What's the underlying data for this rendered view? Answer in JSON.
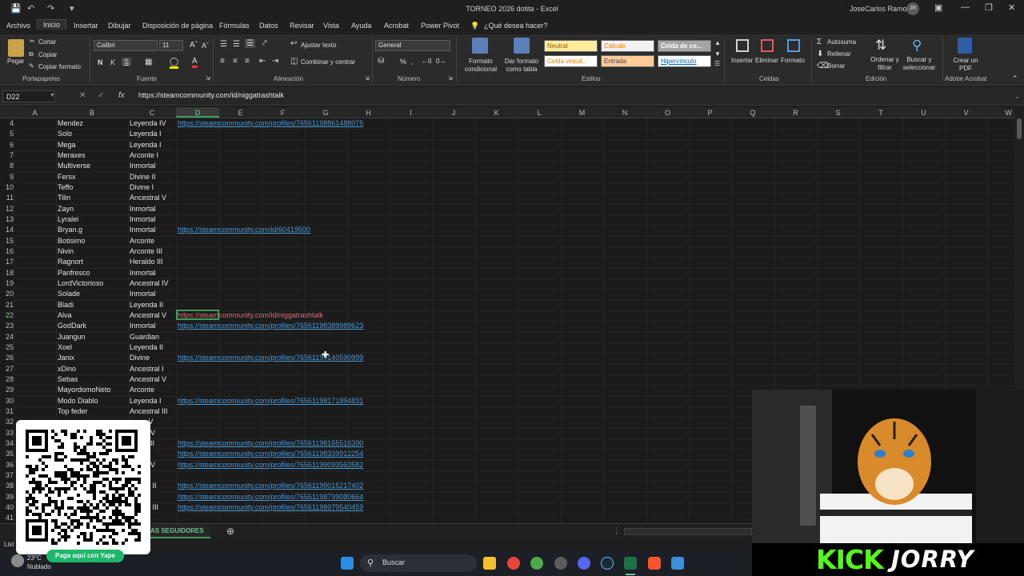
{
  "titlebar": {
    "title": "TORNEO 2026 dotita  -  Excel",
    "user": "JoseCarlos Ramos",
    "user_initials": "JR"
  },
  "ribbon_tabs": [
    "Archivo",
    "Inicio",
    "Insertar",
    "Dibujar",
    "Disposición de página",
    "Fórmulas",
    "Datos",
    "Revisar",
    "Vista",
    "Ayuda",
    "Acrobat",
    "Power Pivot"
  ],
  "tell_me": "¿Qué desea hacer?",
  "ribbon": {
    "clipboard": {
      "paste": "Pegar",
      "cut": "Cortar",
      "copy": "Copiar",
      "format_painter": "Copiar formato",
      "label": "Portapapeles"
    },
    "font": {
      "name": "Calibri",
      "size": "11",
      "label": "Fuente",
      "bold": "N",
      "italic": "K",
      "underline": "S"
    },
    "alignment": {
      "wrap": "Ajustar texto",
      "merge": "Combinar y centrar",
      "label": "Alineación"
    },
    "number": {
      "format": "General",
      "label": "Número",
      "percent": "%"
    },
    "styles": {
      "conditional": "Formato condicional",
      "as_table": "Dar formato como tabla",
      "label": "Estilos",
      "cells": [
        "Neutral",
        "Cálculo",
        "Celda de co...",
        "Celda vincul...",
        "Entrada",
        "Hipervínculo"
      ]
    },
    "cells_group": {
      "insert": "Insertar",
      "delete": "Eliminar",
      "format": "Formato",
      "label": "Celdas"
    },
    "editing": {
      "autosum": "Autosuma",
      "fill": "Rellenar",
      "clear": "Borrar",
      "sort": "Ordenar y filtrar",
      "find": "Buscar y seleccionar",
      "label": "Edición"
    },
    "acrobat": {
      "create": "Crear un PDF",
      "label": "Adobe Acrobat"
    }
  },
  "formula_bar": {
    "name_box": "D22",
    "formula": "https://steamcommunity.com/id/niggatrashtalk"
  },
  "columns": [
    "A",
    "B",
    "C",
    "D",
    "E",
    "F",
    "G",
    "H",
    "I",
    "J",
    "K",
    "L",
    "M",
    "N",
    "O",
    "P",
    "Q",
    "R",
    "S",
    "T",
    "U",
    "V",
    "W"
  ],
  "rows": [
    {
      "n": "4",
      "b": "Mendez",
      "c": "Leyenda IV",
      "d": "https://steamcommunity.com/profiles/76561198861488075"
    },
    {
      "n": "5",
      "b": "Solo",
      "c": "Leyenda I",
      "d": ""
    },
    {
      "n": "6",
      "b": "Mega",
      "c": "Leyenda I",
      "d": ""
    },
    {
      "n": "7",
      "b": "Meraxes",
      "c": "Arconte I",
      "d": ""
    },
    {
      "n": "8",
      "b": "Multiverse",
      "c": "Inmortal",
      "d": ""
    },
    {
      "n": "9",
      "b": "Fersx",
      "c": "Divine II",
      "d": ""
    },
    {
      "n": "10",
      "b": "Teffo",
      "c": "Divine I",
      "d": ""
    },
    {
      "n": "11",
      "b": "Tilin",
      "c": "Ancestral V",
      "d": ""
    },
    {
      "n": "12",
      "b": "Zayn",
      "c": "Inmortal",
      "d": ""
    },
    {
      "n": "13",
      "b": "Lyralei",
      "c": "Inmortal",
      "d": ""
    },
    {
      "n": "14",
      "b": "Bryan.g",
      "c": "Inmortal",
      "d": "https://steamcommunity.com/id/60419500"
    },
    {
      "n": "15",
      "b": "Botisimo",
      "c": "Arconte",
      "d": ""
    },
    {
      "n": "16",
      "b": "Nivin",
      "c": "Arconte III",
      "d": ""
    },
    {
      "n": "17",
      "b": "Ragnort",
      "c": "Heraldo III",
      "d": ""
    },
    {
      "n": "18",
      "b": "Panfresco",
      "c": "Inmortal",
      "d": ""
    },
    {
      "n": "19",
      "b": "LordVictorioso",
      "c": "Ancestral IV",
      "d": ""
    },
    {
      "n": "20",
      "b": "Solade",
      "c": "Inmortal",
      "d": ""
    },
    {
      "n": "21",
      "b": "Bladi",
      "c": "Leyenda II",
      "d": ""
    },
    {
      "n": "22",
      "b": "Alva",
      "c": "Ancestral V",
      "d": "https://steamcommunity.com/id/niggatrashtalk"
    },
    {
      "n": "23",
      "b": "GodDark",
      "c": "Inmortal",
      "d": "https://steamcommunity.com/profiles/76561198389989623"
    },
    {
      "n": "24",
      "b": "Juangun",
      "c": "Guardian",
      "d": ""
    },
    {
      "n": "25",
      "b": "Xoel",
      "c": "Leyenda II",
      "d": ""
    },
    {
      "n": "26",
      "b": "Janix",
      "c": "Divine",
      "d": "https://steamcommunity.com/profiles/76561199140590999"
    },
    {
      "n": "27",
      "b": "xDino",
      "c": "Ancestral I",
      "d": ""
    },
    {
      "n": "28",
      "b": "Sebas",
      "c": "Ancestral V",
      "d": ""
    },
    {
      "n": "29",
      "b": "MayordomoNeto",
      "c": "Arconte",
      "d": ""
    },
    {
      "n": "30",
      "b": "Modo Diablo",
      "c": "Leyenda I",
      "d": "https://steamcommunity.com/profiles/76561198171894831"
    },
    {
      "n": "31",
      "b": "Top feder",
      "c": "Ancestral III",
      "d": ""
    },
    {
      "n": "32",
      "b": "",
      "c": "o V",
      "d": ""
    },
    {
      "n": "33",
      "b": "",
      "c": "o IV",
      "d": ""
    },
    {
      "n": "34",
      "b": "",
      "c": "e III",
      "d": "https://steamcommunity.com/profiles/76561198155516390"
    },
    {
      "n": "35",
      "b": "",
      "c": "III",
      "d": "https://steamcommunity.com/profiles/76561198339912254"
    },
    {
      "n": "36",
      "b": "",
      "c": "o IV",
      "d": "https://steamcommunity.com/profiles/76561199093563582"
    },
    {
      "n": "37",
      "b": "",
      "c": "V",
      "d": ""
    },
    {
      "n": "38",
      "b": "",
      "c": "ral II",
      "d": "https://steamcommunity.com/profiles/76561199015217402"
    },
    {
      "n": "39",
      "b": "",
      "c": "a I",
      "d": "https://steamcommunity.com/profiles/76561198799080664"
    },
    {
      "n": "40",
      "b": "",
      "c": "ral III",
      "d": "https://steamcommunity.com/profiles/76561198979540459"
    },
    {
      "n": "41",
      "b": "",
      "c": "I",
      "d": ""
    }
  ],
  "sheet_tab": "AS SEGUIDORES",
  "status": "List",
  "weather": {
    "temp": "23°C",
    "desc": "Nublado"
  },
  "taskbar": {
    "search": "Buscar"
  },
  "overlay": {
    "yape": "Paga aquí con Yape",
    "kick_logo": "KICK",
    "streamer": "JORRY"
  },
  "colors": {
    "link": "#4b9ad8",
    "excel_green": "#3f9d5a",
    "kick_green": "#53fc18",
    "yape_green": "#1fb86a"
  }
}
